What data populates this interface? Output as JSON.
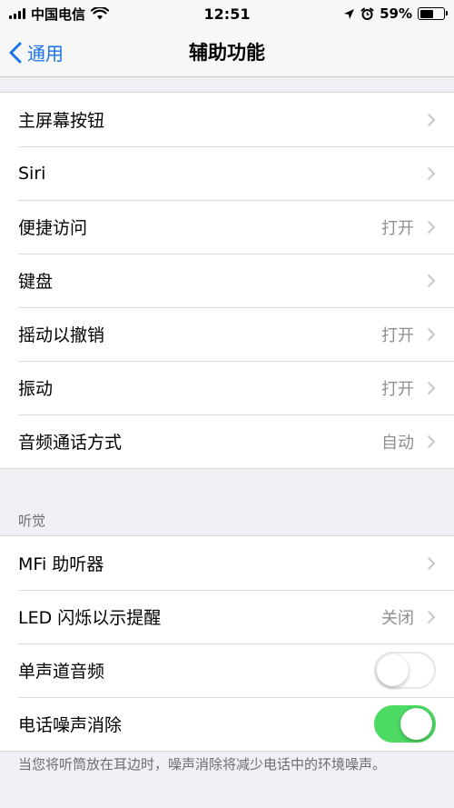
{
  "status_bar": {
    "carrier": "中国电信",
    "time": "12:51",
    "battery": "59%",
    "battery_level": 0.59
  },
  "nav": {
    "back_label": "通用",
    "title": "辅助功能"
  },
  "group1": [
    {
      "label": "主屏幕按钮",
      "value": ""
    },
    {
      "label": "Siri",
      "value": ""
    },
    {
      "label": "便捷访问",
      "value": "打开"
    },
    {
      "label": "键盘",
      "value": ""
    },
    {
      "label": "摇动以撤销",
      "value": "打开"
    },
    {
      "label": "振动",
      "value": "打开"
    },
    {
      "label": "音频通话方式",
      "value": "自动"
    }
  ],
  "hearing": {
    "header": "听觉",
    "rows": [
      {
        "label": "MFi 助听器",
        "value": ""
      },
      {
        "label": "LED 闪烁以示提醒",
        "value": "关闭"
      },
      {
        "label": "单声道音频",
        "toggle": false
      },
      {
        "label": "电话噪声消除",
        "toggle": true
      }
    ],
    "footer": "当您将听筒放在耳边时，噪声消除将减少电话中的环境噪声。"
  },
  "colors": {
    "accent": "#1a73e8",
    "toggle_on": "#4cd964",
    "background": "#efeff4"
  }
}
